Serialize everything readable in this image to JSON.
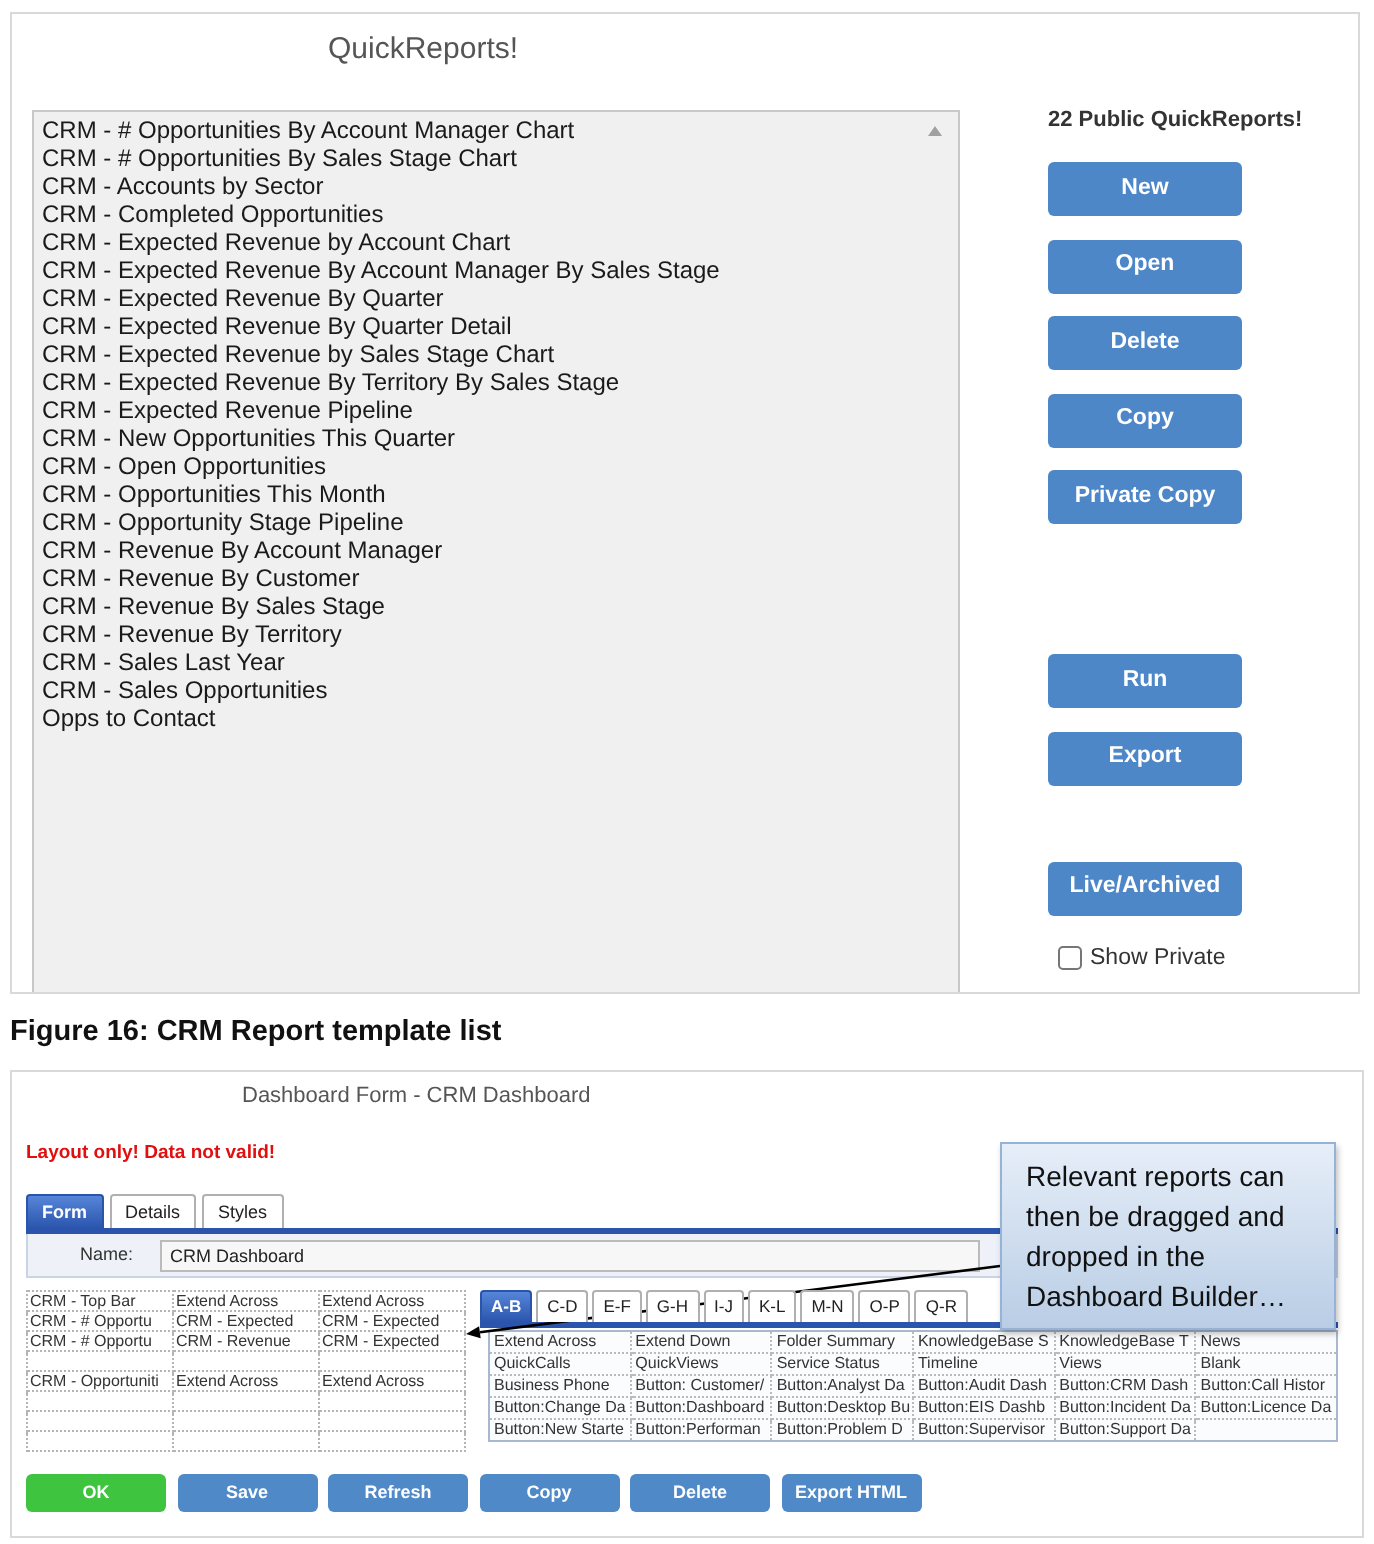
{
  "quick_reports": {
    "title": "QuickReports!",
    "reports": [
      {
        "label": "CRM - # Opportunities By Account Manager Chart",
        "selected": false
      },
      {
        "label": "CRM - # Opportunities By Sales Stage Chart",
        "selected": false
      },
      {
        "label": "CRM - Accounts by Sector",
        "selected": false
      },
      {
        "label": "CRM - Completed Opportunities",
        "selected": false
      },
      {
        "label": "CRM - Expected Revenue by Account Chart",
        "selected": false
      },
      {
        "label": "CRM - Expected Revenue By Account Manager By Sales Stage",
        "selected": false
      },
      {
        "label": "CRM - Expected Revenue By Quarter",
        "selected": false
      },
      {
        "label": "CRM - Expected Revenue By Quarter Detail",
        "selected": false
      },
      {
        "label": "CRM - Expected Revenue by Sales Stage Chart",
        "selected": false
      },
      {
        "label": "CRM - Expected Revenue By Territory By Sales Stage",
        "selected": false
      },
      {
        "label": "CRM - Expected Revenue Pipeline",
        "selected": false
      },
      {
        "label": "CRM - New Opportunities This Quarter",
        "selected": false
      },
      {
        "label": "CRM - Open Opportunities",
        "selected": false
      },
      {
        "label": "CRM - Opportunities This Month",
        "selected": false
      },
      {
        "label": "CRM - Opportunity Stage Pipeline",
        "selected": false
      },
      {
        "label": "CRM - Revenue By Account Manager",
        "selected": false
      },
      {
        "label": "CRM - Revenue By Customer",
        "selected": false
      },
      {
        "label": "CRM - Revenue By Sales Stage",
        "selected": false
      },
      {
        "label": "CRM - Revenue By Territory",
        "selected": false
      },
      {
        "label": "CRM - Sales Last Year",
        "selected": false
      },
      {
        "label": "CRM - Sales Opportunities",
        "selected": false
      },
      {
        "label": "Opps to Contact",
        "selected": false
      }
    ],
    "count_label": "22 Public QuickReports!",
    "button_groups": [
      [
        "New",
        "Open",
        "Delete",
        "Copy",
        "Private Copy"
      ],
      [
        "Run",
        "Export"
      ],
      [
        "Live/Archived"
      ]
    ],
    "show_private": {
      "label": "Show Private",
      "checked": false
    }
  },
  "caption": "Figure 16: CRM Report template list",
  "dashboard_form": {
    "title": "Dashboard Form - CRM Dashboard",
    "warning": "Layout only! Data not valid!",
    "tabs": [
      {
        "label": "Form",
        "selected": true
      },
      {
        "label": "Details",
        "selected": false
      },
      {
        "label": "Styles",
        "selected": false
      }
    ],
    "name_field": {
      "label": "Name:",
      "value": "CRM Dashboard"
    },
    "layout_grid": {
      "rows": [
        {
          "kind": "filled",
          "cells": [
            "CRM - Top Bar",
            "Extend Across",
            "Extend Across"
          ]
        },
        {
          "kind": "filled",
          "cells": [
            "CRM - # Opportu",
            "CRM - Expected",
            "CRM - Expected"
          ]
        },
        {
          "kind": "filled",
          "cells": [
            "CRM - # Opportu",
            "CRM - Revenue",
            "CRM - Expected"
          ]
        },
        {
          "kind": "blank"
        },
        {
          "kind": "filled",
          "cells": [
            "CRM - Opportuniti",
            "Extend Across",
            "Extend Across"
          ]
        },
        {
          "kind": "blank"
        },
        {
          "kind": "blank"
        },
        {
          "kind": "blank"
        }
      ]
    },
    "widget_tabs": [
      {
        "label": "A-B",
        "selected": true
      },
      {
        "label": "C-D",
        "selected": false
      },
      {
        "label": "E-F",
        "selected": false
      },
      {
        "label": "G-H",
        "selected": false
      },
      {
        "label": "I-J",
        "selected": false
      },
      {
        "label": "K-L",
        "selected": false
      },
      {
        "label": "M-N",
        "selected": false
      },
      {
        "label": "O-P",
        "selected": false
      },
      {
        "label": "Q-R",
        "selected": false
      }
    ],
    "widget_grid": {
      "rows": [
        [
          "Extend Across",
          "Extend Down",
          "Folder Summary",
          "KnowledgeBase S",
          "KnowledgeBase T",
          "News"
        ],
        [
          "QuickCalls",
          "QuickViews",
          "Service Status",
          "Timeline",
          "Views",
          "Blank"
        ],
        [
          "Business Phone",
          "Button: Customer/",
          "Button:Analyst Da",
          "Button:Audit Dash",
          "Button:CRM Dash",
          "Button:Call Histor"
        ],
        [
          "Button:Change Da",
          "Button:Dashboard",
          "Button:Desktop Bu",
          "Button:EIS Dashb",
          "Button:Incident Da",
          "Button:Licence Da"
        ],
        [
          "Button:New Starte",
          "Button:Performan",
          "Button:Problem D",
          "Button:Supervisor",
          "Button:Support Da"
        ]
      ]
    },
    "buttons": [
      {
        "label": "OK",
        "kind": "confirm"
      },
      {
        "label": "Save",
        "kind": "default"
      },
      {
        "label": "Refresh",
        "kind": "default"
      },
      {
        "label": "Copy",
        "kind": "default"
      },
      {
        "label": "Delete",
        "kind": "default"
      },
      {
        "label": "Export HTML",
        "kind": "default"
      }
    ],
    "callout": "Relevant reports can then be dragged and dropped in the Dashboard Builder…"
  }
}
